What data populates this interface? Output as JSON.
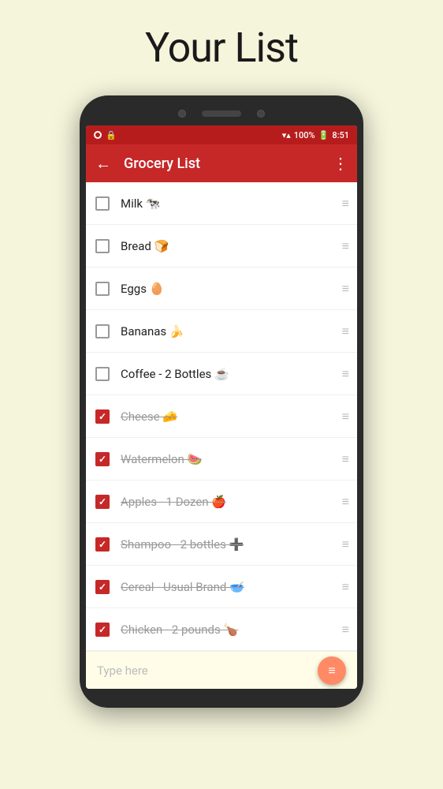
{
  "page": {
    "title": "Your List"
  },
  "app_bar": {
    "title": "Grocery List",
    "back_label": "←",
    "more_label": "⋮"
  },
  "status_bar": {
    "signal": "▼▲",
    "battery": "100%",
    "time": "8:51"
  },
  "list_items": [
    {
      "id": 1,
      "text": "Milk 🐄",
      "checked": false
    },
    {
      "id": 2,
      "text": "Bread 🍞",
      "checked": false
    },
    {
      "id": 3,
      "text": "Eggs 🥚",
      "checked": false
    },
    {
      "id": 4,
      "text": "Bananas 🍌",
      "checked": false
    },
    {
      "id": 5,
      "text": "Coffee - 2 Bottles ☕",
      "checked": false
    },
    {
      "id": 6,
      "text": "Cheese 🧀",
      "checked": true
    },
    {
      "id": 7,
      "text": "Watermelon 🍉",
      "checked": true
    },
    {
      "id": 8,
      "text": "Apples - 1 Dozen 🍎",
      "checked": true
    },
    {
      "id": 9,
      "text": "Shampoo - 2 bottles ➕",
      "checked": true
    },
    {
      "id": 10,
      "text": "Cereal - Usual Brand 🥣",
      "checked": true
    },
    {
      "id": 11,
      "text": "Chicken - 2 pounds 🍗",
      "checked": true
    }
  ],
  "input_bar": {
    "placeholder": "Type here",
    "fab_icon": "≡+"
  }
}
